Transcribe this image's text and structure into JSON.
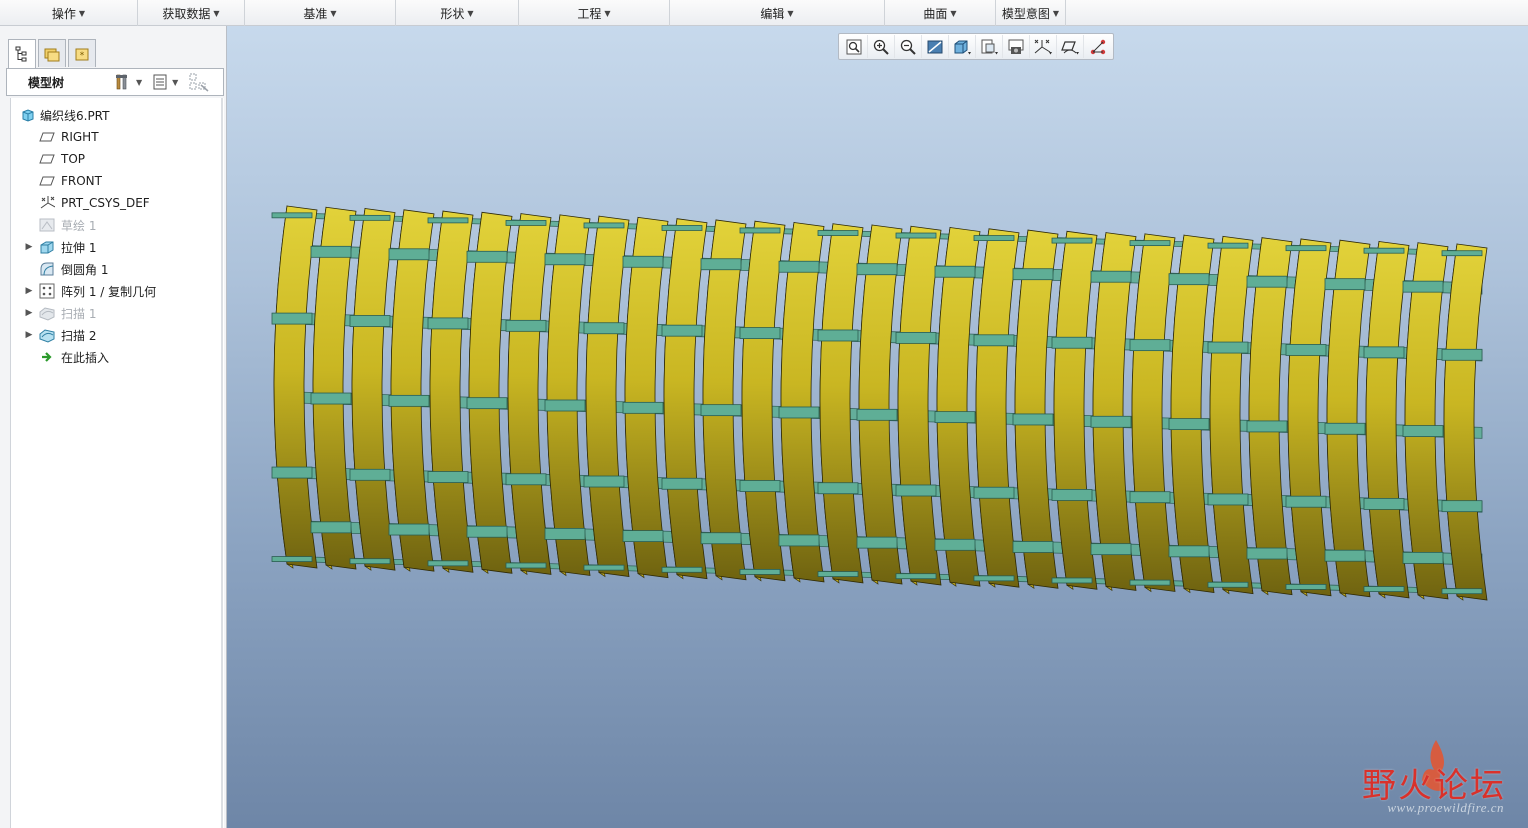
{
  "ribbon": {
    "groups": [
      {
        "label": "操作"
      },
      {
        "label": "获取数据"
      },
      {
        "label": "基准"
      },
      {
        "label": "形状"
      },
      {
        "label": "工程"
      },
      {
        "label": "编辑"
      },
      {
        "label": "曲面"
      },
      {
        "label": "模型意图"
      }
    ]
  },
  "left_panel": {
    "tabs": [
      "model-tree-tab",
      "folder-browser-tab",
      "favorites-tab"
    ],
    "tree_title": "模型树",
    "nodes": [
      {
        "label": "编织线6.PRT",
        "icon": "part-icon",
        "expandable": false,
        "dim": false
      },
      {
        "label": "RIGHT",
        "icon": "datum-plane-icon",
        "expandable": false,
        "dim": false
      },
      {
        "label": "TOP",
        "icon": "datum-plane-icon",
        "expandable": false,
        "dim": false
      },
      {
        "label": "FRONT",
        "icon": "datum-plane-icon",
        "expandable": false,
        "dim": false
      },
      {
        "label": "PRT_CSYS_DEF",
        "icon": "csys-icon",
        "expandable": false,
        "dim": false
      },
      {
        "label": "草绘 1",
        "icon": "sketch-icon",
        "expandable": false,
        "dim": true
      },
      {
        "label": "拉伸 1",
        "icon": "extrude-icon",
        "expandable": true,
        "dim": false
      },
      {
        "label": "倒圆角 1",
        "icon": "round-icon",
        "expandable": false,
        "dim": false
      },
      {
        "label": "阵列 1 / 复制几何",
        "icon": "pattern-icon",
        "expandable": true,
        "dim": false
      },
      {
        "label": "扫描 1",
        "icon": "sweep-icon",
        "expandable": true,
        "dim": true
      },
      {
        "label": "扫描 2",
        "icon": "sweep-icon",
        "expandable": true,
        "dim": false
      },
      {
        "label": "在此插入",
        "icon": "insert-here-arrow-icon",
        "expandable": false,
        "dim": false
      }
    ]
  },
  "view_toolbar": {
    "buttons": [
      "refit-icon",
      "zoom-in-icon",
      "zoom-out-icon",
      "repaint-icon",
      "display-style-icon",
      "saved-orientations-icon",
      "view-manager-icon",
      "datum-display-icon",
      "spin-center-icon",
      "annotation-display-icon"
    ]
  },
  "viewport": {
    "background_top": "#c7d9ec",
    "background_bottom": "#6e86a7",
    "strip_color": "#c9b622",
    "strip_shadow": "#6f6310",
    "rod_color": "#5fae96",
    "rod_edge": "#2a5d52"
  },
  "watermark": {
    "brand": "野火论坛",
    "url": "www.proewildfire.cn"
  }
}
